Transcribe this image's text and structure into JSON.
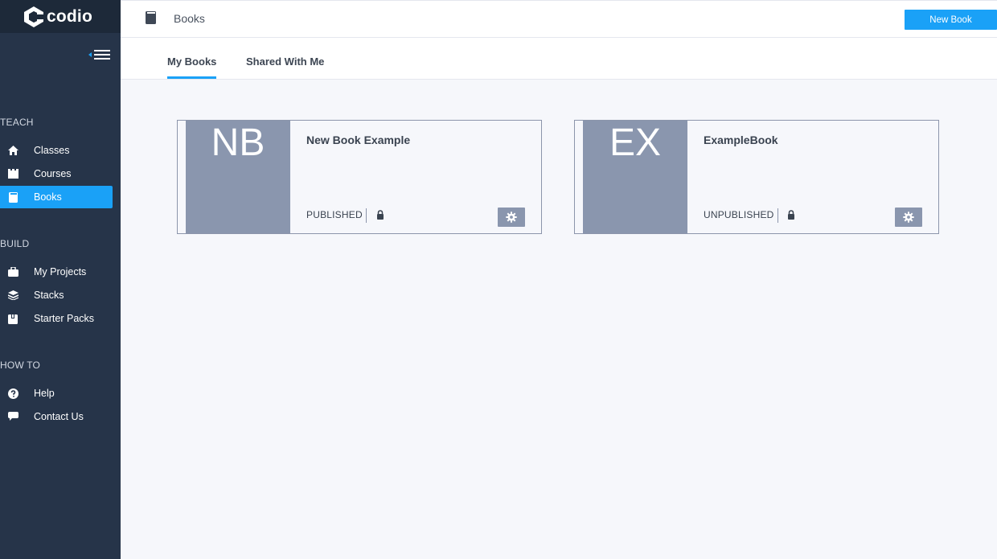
{
  "app": {
    "logo_text": "codio"
  },
  "sidebar": {
    "sections": [
      {
        "title": "TEACH",
        "items": [
          {
            "label": "Classes",
            "icon": "home-icon"
          },
          {
            "label": "Courses",
            "icon": "castle-icon"
          },
          {
            "label": "Books",
            "icon": "book-icon",
            "active": true
          }
        ]
      },
      {
        "title": "BUILD",
        "items": [
          {
            "label": "My Projects",
            "icon": "briefcase-icon"
          },
          {
            "label": "Stacks",
            "icon": "layers-icon"
          },
          {
            "label": "Starter Packs",
            "icon": "package-icon"
          }
        ]
      },
      {
        "title": "HOW TO",
        "items": [
          {
            "label": "Help",
            "icon": "question-icon"
          },
          {
            "label": "Contact Us",
            "icon": "chat-bubble-icon"
          }
        ]
      }
    ]
  },
  "header": {
    "title": "Books",
    "new_book_label": "New Book"
  },
  "tabs": [
    {
      "label": "My Books",
      "active": true
    },
    {
      "label": "Shared With Me",
      "active": false
    }
  ],
  "books": [
    {
      "cover_text": "NB",
      "title": "New Book Example",
      "status": "PUBLISHED"
    },
    {
      "cover_text": "EX",
      "title": "ExampleBook",
      "status": "UNPUBLISHED"
    }
  ],
  "colors": {
    "sidebar_bg": "#263449",
    "accent": "#1aa1f7",
    "cover_bg": "#8a96ae"
  }
}
